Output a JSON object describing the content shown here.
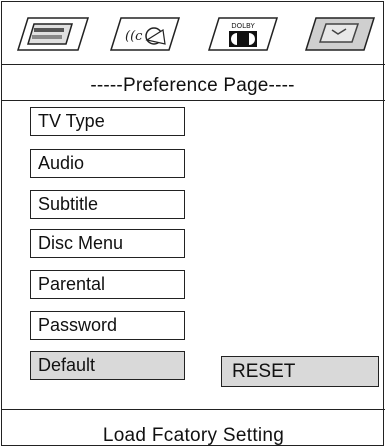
{
  "tabs": [
    {
      "icon": "general-setup-icon"
    },
    {
      "icon": "speaker-setup-icon"
    },
    {
      "icon": "dolby-setup-icon",
      "label": "DOLBY"
    },
    {
      "icon": "preference-setup-icon"
    }
  ],
  "page_title": "-----Preference Page----",
  "menu": {
    "items": [
      {
        "label": "TV Type"
      },
      {
        "label": "Audio"
      },
      {
        "label": "Subtitle"
      },
      {
        "label": "Disc Menu"
      },
      {
        "label": "Parental"
      },
      {
        "label": "Password"
      },
      {
        "label": "Default"
      }
    ],
    "selected": "Default"
  },
  "submenu": {
    "reset_label": "RESET"
  },
  "status": {
    "text": "Load Fcatory  Setting"
  },
  "colors": {
    "border": "#222222",
    "highlight": "#d9d9d9",
    "background": "#ffffff"
  }
}
